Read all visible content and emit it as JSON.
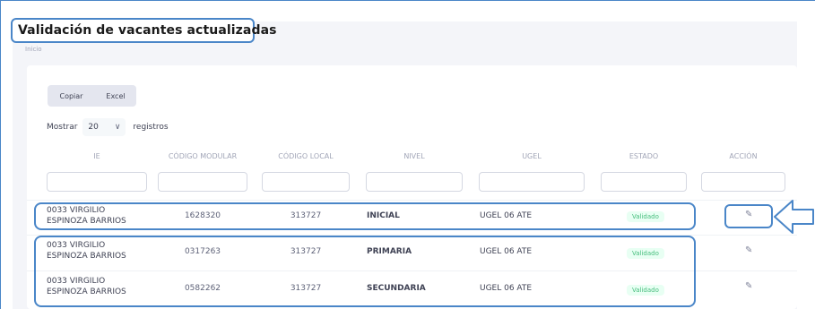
{
  "header": {
    "title": "Validación de vacantes actualizadas",
    "breadcrumb": "Inicio"
  },
  "toolbar": {
    "copy_label": "Copiar",
    "excel_label": "Excel"
  },
  "length": {
    "prefix": "Mostrar",
    "value": "20",
    "suffix": "registros"
  },
  "table": {
    "columns": [
      "IE",
      "CÓDIGO MODULAR",
      "CÓDIGO LOCAL",
      "NIVEL",
      "UGEL",
      "ESTADO",
      "ACCIÓN"
    ],
    "rows": [
      {
        "ie_line1": "0033 VIRGILIO",
        "ie_line2": "ESPINOZA BARRIOS",
        "codigo_modular": "1628320",
        "codigo_local": "313727",
        "nivel": "INICIAL",
        "ugel": "UGEL 06 ATE",
        "estado": "Validado"
      },
      {
        "ie_line1": "0033 VIRGILIO",
        "ie_line2": "ESPINOZA BARRIOS",
        "codigo_modular": "0317263",
        "codigo_local": "313727",
        "nivel": "PRIMARIA",
        "ugel": "UGEL 06 ATE",
        "estado": "Validado"
      },
      {
        "ie_line1": "0033 VIRGILIO",
        "ie_line2": "ESPINOZA BARRIOS",
        "codigo_modular": "0582262",
        "codigo_local": "313727",
        "nivel": "SECUNDARIA",
        "ugel": "UGEL 06 ATE",
        "estado": "Validado"
      }
    ]
  },
  "icons": {
    "edit": "edit-icon",
    "arrow": "left-arrow-annotation"
  },
  "colors": {
    "highlight": "#4a86c8",
    "status_green": "#47be7d",
    "status_bg": "#e8fff3"
  }
}
